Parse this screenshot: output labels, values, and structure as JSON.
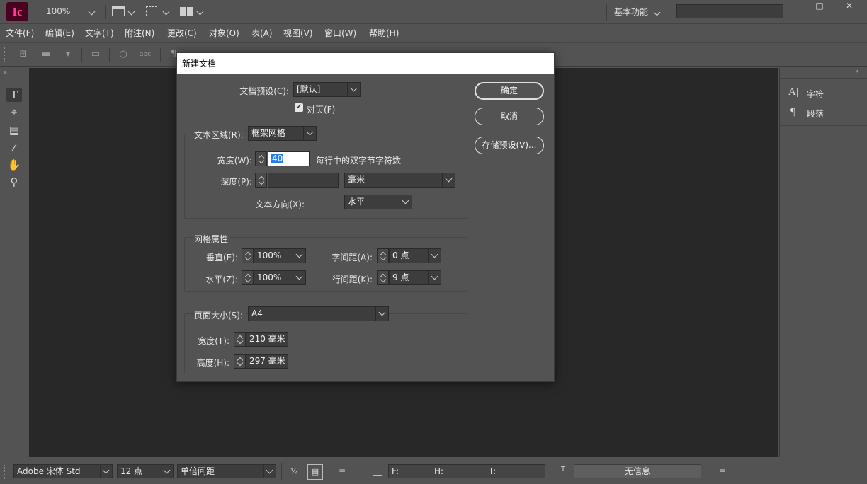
{
  "app": {
    "logo_text": "Ic",
    "zoom": "100%",
    "workspace": "基本功能",
    "search_placeholder": ""
  },
  "window": {
    "minimize": "—",
    "maximize": "□",
    "close": "✕"
  },
  "menu": [
    "文件(F)",
    "编辑(E)",
    "文字(T)",
    "附注(N)",
    "更改(C)",
    "对象(O)",
    "表(A)",
    "视图(V)",
    "窗口(W)",
    "帮助(H)"
  ],
  "right_panel": {
    "items": [
      {
        "label": "字符",
        "icon": "character-icon"
      },
      {
        "label": "段落",
        "icon": "paragraph-icon"
      }
    ]
  },
  "status_bar": {
    "font": "Adobe 宋体 Std",
    "font_size": "12 点",
    "leading": "单倍间距",
    "f_label": "F:",
    "h_label": "H:",
    "t_label": "T:",
    "info": "无信息"
  },
  "dialog": {
    "title": "新建文档",
    "preset_label": "文档预设(C):",
    "preset_value": "[默认]",
    "facing_label": "对页(F)",
    "facing_checked": true,
    "text_area_label": "文本区域(R):",
    "text_area_value": "框架网格",
    "width_label": "宽度(W):",
    "width_value": "40",
    "width_hint": "每行中的双字节字符数",
    "depth_label": "深度(P):",
    "depth_value": "",
    "depth_unit": "毫米",
    "direction_label": "文本方向(X):",
    "direction_value": "水平",
    "grid_group": "网格属性",
    "vertical_label": "垂直(E):",
    "vertical_value": "100%",
    "horizontal_label": "水平(Z):",
    "horizontal_value": "100%",
    "char_spacing_label": "字间距(A):",
    "char_spacing_value": "0 点",
    "line_spacing_label": "行间距(K):",
    "line_spacing_value": "9 点",
    "page_size_label": "页面大小(S):",
    "page_size_value": "A4",
    "page_width_label": "宽度(T):",
    "page_width_value": "210 毫米",
    "page_height_label": "高度(H):",
    "page_height_value": "297 毫米",
    "ok": "确定",
    "cancel": "取消",
    "save_preset": "存储预设(V)..."
  }
}
